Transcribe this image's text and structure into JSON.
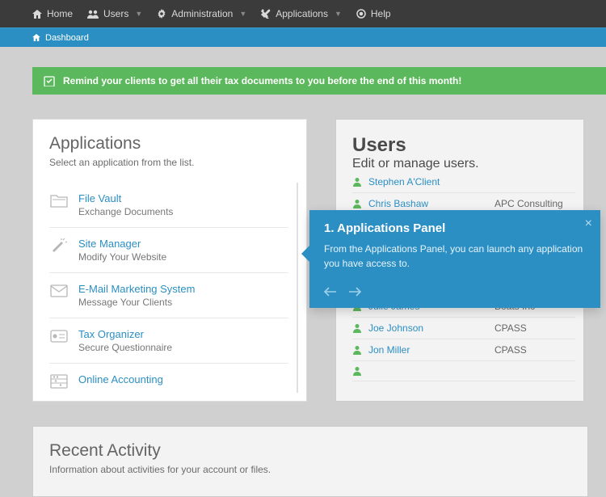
{
  "nav": {
    "home": "Home",
    "users": "Users",
    "admin": "Administration",
    "apps": "Applications",
    "help": "Help"
  },
  "breadcrumb": {
    "label": "Dashboard"
  },
  "alert": {
    "text": "Remind your clients to get all their tax documents to you before the end of this month!"
  },
  "apps_panel": {
    "title": "Applications",
    "subtitle": "Select an application from the list.",
    "items": [
      {
        "title": "File Vault",
        "desc": "Exchange Documents",
        "icon": "folder"
      },
      {
        "title": "Site Manager",
        "desc": "Modify Your Website",
        "icon": "wand"
      },
      {
        "title": "E-Mail Marketing System",
        "desc": "Message Your Clients",
        "icon": "envelope"
      },
      {
        "title": "Tax Organizer",
        "desc": "Secure Questionnaire",
        "icon": "card"
      },
      {
        "title": "Online Accounting",
        "desc": "",
        "icon": "abacus"
      }
    ]
  },
  "users_panel": {
    "title": "Users",
    "subtitle": "Edit or manage users.",
    "rows": [
      {
        "name": "Stephen A'Client",
        "org": ""
      },
      {
        "name": "Chris Bashaw",
        "org": "APC Consulting"
      },
      {
        "name": "",
        "org": ""
      },
      {
        "name": "",
        "org": ""
      },
      {
        "name": "",
        "org": ""
      },
      {
        "name": "",
        "org": ""
      },
      {
        "name": "Julie James",
        "org": "Boats Inc"
      },
      {
        "name": "Joe Johnson",
        "org": "CPASS"
      },
      {
        "name": "Jon Miller",
        "org": "CPASS"
      },
      {
        "name": "",
        "org": ""
      }
    ]
  },
  "tour": {
    "title": "1. Applications Panel",
    "body": "From the Applications Panel, you can launch any application you have access to."
  },
  "recent": {
    "title": "Recent Activity",
    "subtitle": "Information about activities for your account or files."
  }
}
